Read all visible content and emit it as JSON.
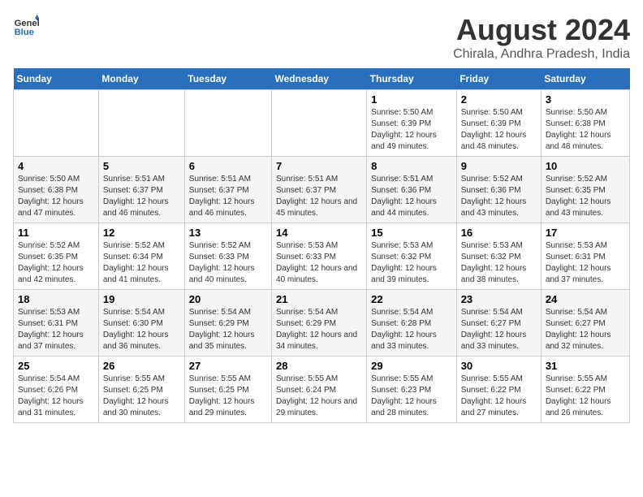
{
  "header": {
    "logo_line1": "General",
    "logo_line2": "Blue",
    "title": "August 2024",
    "subtitle": "Chirala, Andhra Pradesh, India"
  },
  "days_of_week": [
    "Sunday",
    "Monday",
    "Tuesday",
    "Wednesday",
    "Thursday",
    "Friday",
    "Saturday"
  ],
  "weeks": [
    [
      {
        "day": "",
        "sunrise": "",
        "sunset": "",
        "daylight": ""
      },
      {
        "day": "",
        "sunrise": "",
        "sunset": "",
        "daylight": ""
      },
      {
        "day": "",
        "sunrise": "",
        "sunset": "",
        "daylight": ""
      },
      {
        "day": "",
        "sunrise": "",
        "sunset": "",
        "daylight": ""
      },
      {
        "day": "1",
        "sunrise": "Sunrise: 5:50 AM",
        "sunset": "Sunset: 6:39 PM",
        "daylight": "Daylight: 12 hours and 49 minutes."
      },
      {
        "day": "2",
        "sunrise": "Sunrise: 5:50 AM",
        "sunset": "Sunset: 6:39 PM",
        "daylight": "Daylight: 12 hours and 48 minutes."
      },
      {
        "day": "3",
        "sunrise": "Sunrise: 5:50 AM",
        "sunset": "Sunset: 6:38 PM",
        "daylight": "Daylight: 12 hours and 48 minutes."
      }
    ],
    [
      {
        "day": "4",
        "sunrise": "Sunrise: 5:50 AM",
        "sunset": "Sunset: 6:38 PM",
        "daylight": "Daylight: 12 hours and 47 minutes."
      },
      {
        "day": "5",
        "sunrise": "Sunrise: 5:51 AM",
        "sunset": "Sunset: 6:37 PM",
        "daylight": "Daylight: 12 hours and 46 minutes."
      },
      {
        "day": "6",
        "sunrise": "Sunrise: 5:51 AM",
        "sunset": "Sunset: 6:37 PM",
        "daylight": "Daylight: 12 hours and 46 minutes."
      },
      {
        "day": "7",
        "sunrise": "Sunrise: 5:51 AM",
        "sunset": "Sunset: 6:37 PM",
        "daylight": "Daylight: 12 hours and 45 minutes."
      },
      {
        "day": "8",
        "sunrise": "Sunrise: 5:51 AM",
        "sunset": "Sunset: 6:36 PM",
        "daylight": "Daylight: 12 hours and 44 minutes."
      },
      {
        "day": "9",
        "sunrise": "Sunrise: 5:52 AM",
        "sunset": "Sunset: 6:36 PM",
        "daylight": "Daylight: 12 hours and 43 minutes."
      },
      {
        "day": "10",
        "sunrise": "Sunrise: 5:52 AM",
        "sunset": "Sunset: 6:35 PM",
        "daylight": "Daylight: 12 hours and 43 minutes."
      }
    ],
    [
      {
        "day": "11",
        "sunrise": "Sunrise: 5:52 AM",
        "sunset": "Sunset: 6:35 PM",
        "daylight": "Daylight: 12 hours and 42 minutes."
      },
      {
        "day": "12",
        "sunrise": "Sunrise: 5:52 AM",
        "sunset": "Sunset: 6:34 PM",
        "daylight": "Daylight: 12 hours and 41 minutes."
      },
      {
        "day": "13",
        "sunrise": "Sunrise: 5:52 AM",
        "sunset": "Sunset: 6:33 PM",
        "daylight": "Daylight: 12 hours and 40 minutes."
      },
      {
        "day": "14",
        "sunrise": "Sunrise: 5:53 AM",
        "sunset": "Sunset: 6:33 PM",
        "daylight": "Daylight: 12 hours and 40 minutes."
      },
      {
        "day": "15",
        "sunrise": "Sunrise: 5:53 AM",
        "sunset": "Sunset: 6:32 PM",
        "daylight": "Daylight: 12 hours and 39 minutes."
      },
      {
        "day": "16",
        "sunrise": "Sunrise: 5:53 AM",
        "sunset": "Sunset: 6:32 PM",
        "daylight": "Daylight: 12 hours and 38 minutes."
      },
      {
        "day": "17",
        "sunrise": "Sunrise: 5:53 AM",
        "sunset": "Sunset: 6:31 PM",
        "daylight": "Daylight: 12 hours and 37 minutes."
      }
    ],
    [
      {
        "day": "18",
        "sunrise": "Sunrise: 5:53 AM",
        "sunset": "Sunset: 6:31 PM",
        "daylight": "Daylight: 12 hours and 37 minutes."
      },
      {
        "day": "19",
        "sunrise": "Sunrise: 5:54 AM",
        "sunset": "Sunset: 6:30 PM",
        "daylight": "Daylight: 12 hours and 36 minutes."
      },
      {
        "day": "20",
        "sunrise": "Sunrise: 5:54 AM",
        "sunset": "Sunset: 6:29 PM",
        "daylight": "Daylight: 12 hours and 35 minutes."
      },
      {
        "day": "21",
        "sunrise": "Sunrise: 5:54 AM",
        "sunset": "Sunset: 6:29 PM",
        "daylight": "Daylight: 12 hours and 34 minutes."
      },
      {
        "day": "22",
        "sunrise": "Sunrise: 5:54 AM",
        "sunset": "Sunset: 6:28 PM",
        "daylight": "Daylight: 12 hours and 33 minutes."
      },
      {
        "day": "23",
        "sunrise": "Sunrise: 5:54 AM",
        "sunset": "Sunset: 6:27 PM",
        "daylight": "Daylight: 12 hours and 33 minutes."
      },
      {
        "day": "24",
        "sunrise": "Sunrise: 5:54 AM",
        "sunset": "Sunset: 6:27 PM",
        "daylight": "Daylight: 12 hours and 32 minutes."
      }
    ],
    [
      {
        "day": "25",
        "sunrise": "Sunrise: 5:54 AM",
        "sunset": "Sunset: 6:26 PM",
        "daylight": "Daylight: 12 hours and 31 minutes."
      },
      {
        "day": "26",
        "sunrise": "Sunrise: 5:55 AM",
        "sunset": "Sunset: 6:25 PM",
        "daylight": "Daylight: 12 hours and 30 minutes."
      },
      {
        "day": "27",
        "sunrise": "Sunrise: 5:55 AM",
        "sunset": "Sunset: 6:25 PM",
        "daylight": "Daylight: 12 hours and 29 minutes."
      },
      {
        "day": "28",
        "sunrise": "Sunrise: 5:55 AM",
        "sunset": "Sunset: 6:24 PM",
        "daylight": "Daylight: 12 hours and 29 minutes."
      },
      {
        "day": "29",
        "sunrise": "Sunrise: 5:55 AM",
        "sunset": "Sunset: 6:23 PM",
        "daylight": "Daylight: 12 hours and 28 minutes."
      },
      {
        "day": "30",
        "sunrise": "Sunrise: 5:55 AM",
        "sunset": "Sunset: 6:22 PM",
        "daylight": "Daylight: 12 hours and 27 minutes."
      },
      {
        "day": "31",
        "sunrise": "Sunrise: 5:55 AM",
        "sunset": "Sunset: 6:22 PM",
        "daylight": "Daylight: 12 hours and 26 minutes."
      }
    ]
  ]
}
